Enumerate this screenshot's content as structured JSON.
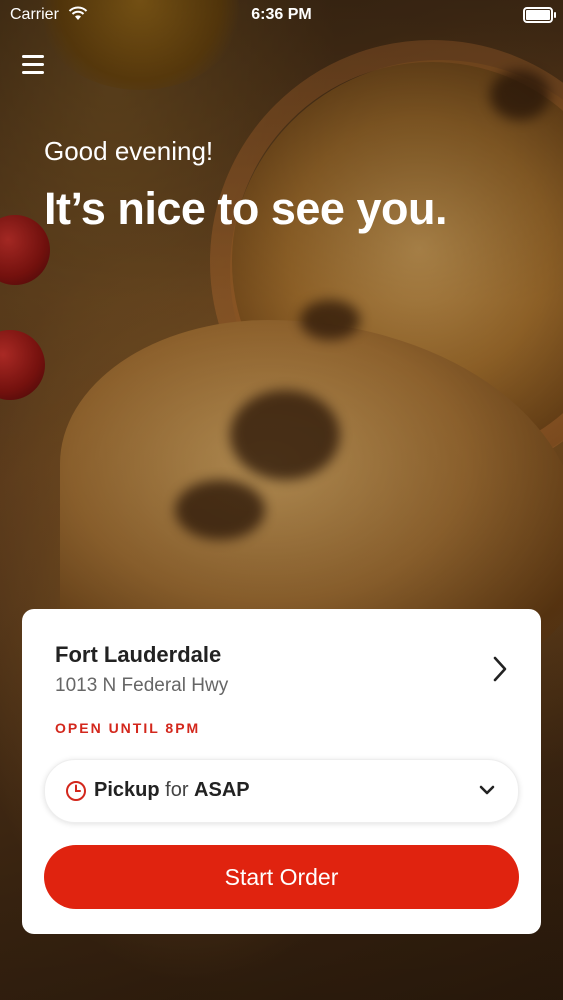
{
  "status_bar": {
    "carrier": "Carrier",
    "time": "6:36 PM",
    "battery_level": 1.0
  },
  "header": {
    "menu_icon": "hamburger-menu-icon",
    "greeting": "Good evening!",
    "headline": "It’s nice to see you."
  },
  "location_card": {
    "city": "Fort Lauderdale",
    "address": "1013 N Federal Hwy",
    "hours": "OPEN UNTIL 8PM",
    "hours_color": "#d3271c",
    "pickup": {
      "mode": "Pickup",
      "connector": "for",
      "time": "ASAP",
      "icon": "clock-icon"
    },
    "start_button_label": "Start Order",
    "accent_color": "#e0230f"
  }
}
